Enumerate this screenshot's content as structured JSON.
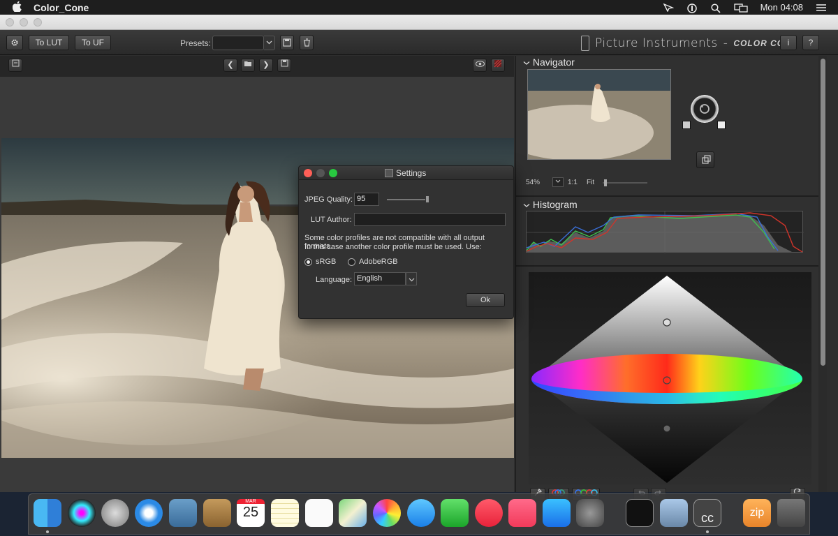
{
  "menubar": {
    "app_name": "Color_Cone",
    "clock": "Mon 04:08"
  },
  "toolbar": {
    "to_lut": "To LUT",
    "to_uf": "To UF",
    "presets_label": "Presets:",
    "brand_name": "Picture Instruments",
    "brand_dash": "-",
    "brand_product": "COLOR CONE",
    "info_label": "i",
    "help_label": "?"
  },
  "navigator": {
    "title": "Navigator",
    "zoom_percent": "54%",
    "zoom_1to1": "1:1",
    "zoom_fit": "Fit"
  },
  "histogram": {
    "title": "Histogram"
  },
  "settings_dialog": {
    "title": "Settings",
    "jpeg_quality_label": "JPEG Quality:",
    "jpeg_quality_value": "95",
    "jpeg_quality_slider": 0.95,
    "lut_author_label": "LUT Author:",
    "lut_author_value": "",
    "note_line1": "Some color profiles are not compatible with all output formats.",
    "note_line2": "In this case another color profile must be used. Use:",
    "profile_srgb": "sRGB",
    "profile_adobergb": "AdobeRGB",
    "selected_profile": "sRGB",
    "language_label": "Language:",
    "language_value": "English",
    "ok_label": "Ok"
  },
  "dock": {
    "calendar_month": "MAR",
    "calendar_day": "25",
    "zip_label": "zip",
    "cc_label": "cc"
  },
  "colors": {
    "accent_red": "#ff5f57",
    "accent_yellow": "#febc2e",
    "accent_green": "#28c840"
  }
}
